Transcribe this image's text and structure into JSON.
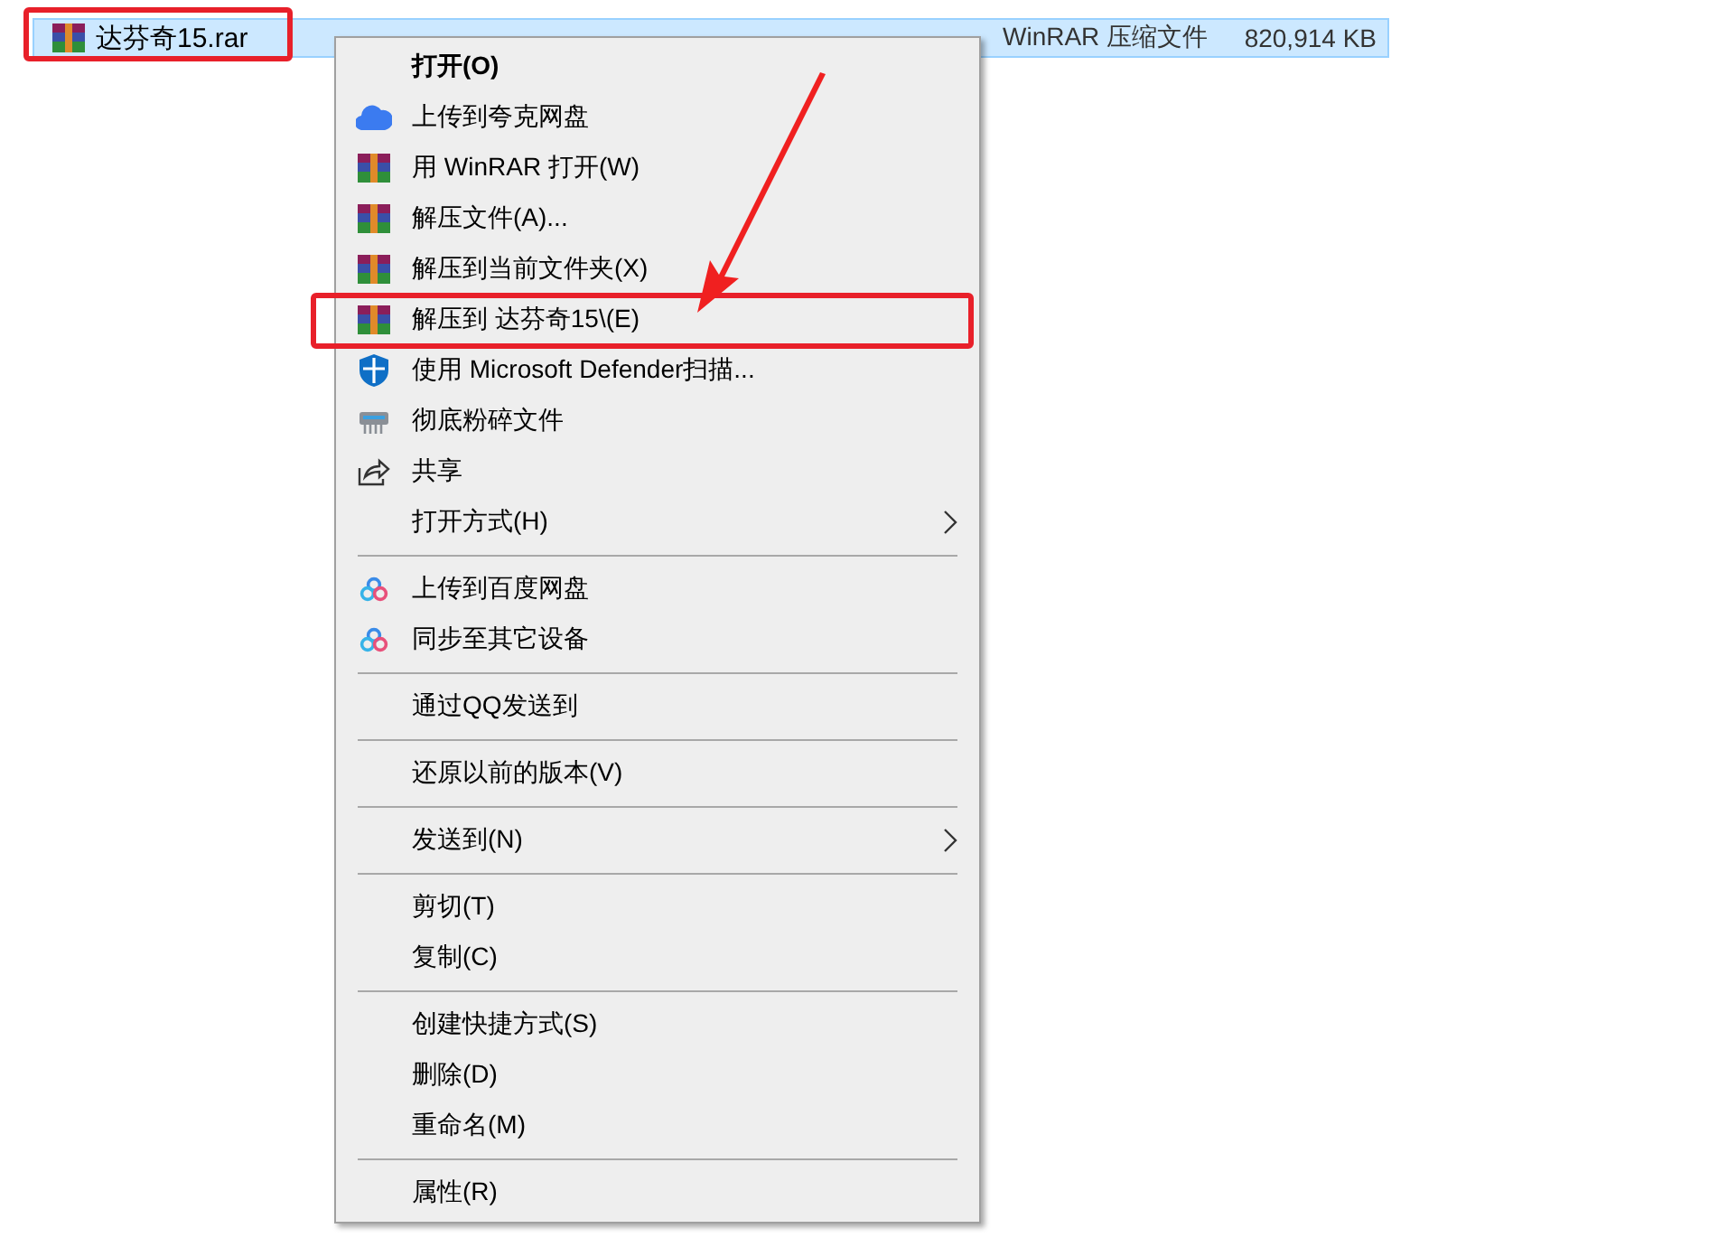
{
  "file_row": {
    "name": "达芬奇15.rar",
    "type": "WinRAR 压缩文件",
    "size": "820,914 KB",
    "selected": true,
    "annotated": true
  },
  "context_menu": {
    "groups": [
      [
        {
          "label": "打开(O)",
          "kind": "none",
          "bold": true
        },
        {
          "label": "上传到夸克网盘",
          "kind": "cloud"
        },
        {
          "label": "用 WinRAR 打开(W)",
          "kind": "archive"
        },
        {
          "label": "解压文件(A)...",
          "kind": "archive"
        },
        {
          "label": "解压到当前文件夹(X)",
          "kind": "archive"
        },
        {
          "label": "解压到 达芬奇15\\(E)",
          "kind": "archive",
          "annotated": true
        },
        {
          "label": "使用 Microsoft Defender扫描...",
          "kind": "shield"
        },
        {
          "label": "彻底粉碎文件",
          "kind": "shredder"
        },
        {
          "label": "共享",
          "kind": "share"
        },
        {
          "label": "打开方式(H)",
          "kind": "none",
          "submenu": true
        }
      ],
      [
        {
          "label": "上传到百度网盘",
          "kind": "rings"
        },
        {
          "label": "同步至其它设备",
          "kind": "rings"
        }
      ],
      [
        {
          "label": "通过QQ发送到",
          "kind": "none"
        }
      ],
      [
        {
          "label": "还原以前的版本(V)",
          "kind": "none"
        }
      ],
      [
        {
          "label": "发送到(N)",
          "kind": "none",
          "submenu": true
        }
      ],
      [
        {
          "label": "剪切(T)",
          "kind": "none"
        },
        {
          "label": "复制(C)",
          "kind": "none"
        }
      ],
      [
        {
          "label": "创建快捷方式(S)",
          "kind": "none"
        },
        {
          "label": "删除(D)",
          "kind": "none"
        },
        {
          "label": "重命名(M)",
          "kind": "none"
        }
      ],
      [
        {
          "label": "属性(R)",
          "kind": "none"
        }
      ]
    ]
  }
}
